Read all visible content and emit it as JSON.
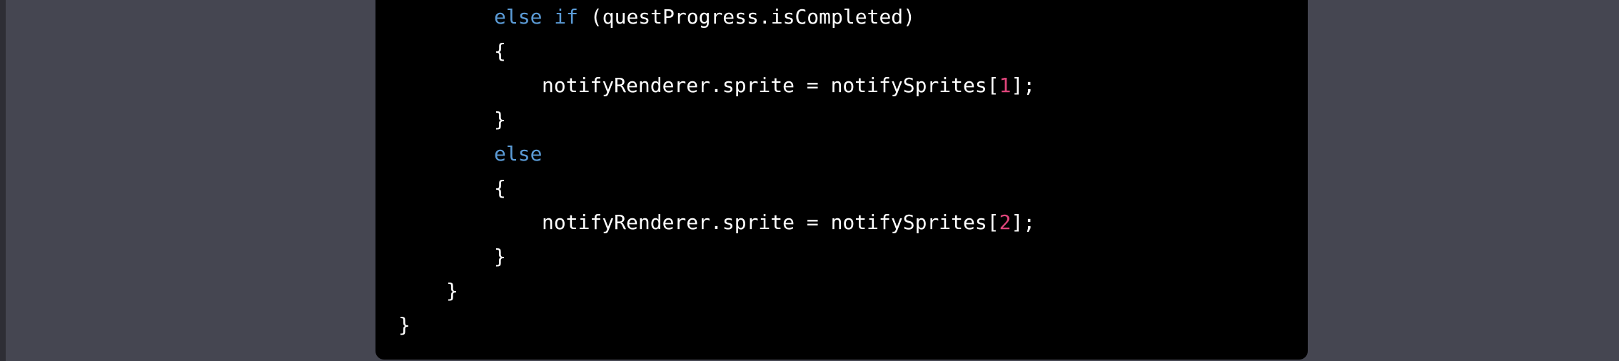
{
  "code": {
    "lines": [
      {
        "indent": 2,
        "tokens": [
          {
            "t": "else",
            "k": "keyword"
          },
          {
            "t": " "
          },
          {
            "t": "if",
            "k": "keyword"
          },
          {
            "t": " (questProgress.isCompleted)"
          }
        ]
      },
      {
        "indent": 2,
        "tokens": [
          {
            "t": "{"
          }
        ]
      },
      {
        "indent": 3,
        "tokens": [
          {
            "t": "notifyRenderer.sprite = notifySprites["
          },
          {
            "t": "1",
            "k": "number"
          },
          {
            "t": "];"
          }
        ]
      },
      {
        "indent": 2,
        "tokens": [
          {
            "t": "}"
          }
        ]
      },
      {
        "indent": 2,
        "tokens": [
          {
            "t": "else",
            "k": "keyword"
          }
        ]
      },
      {
        "indent": 2,
        "tokens": [
          {
            "t": "{"
          }
        ]
      },
      {
        "indent": 3,
        "tokens": [
          {
            "t": "notifyRenderer.sprite = notifySprites["
          },
          {
            "t": "2",
            "k": "number"
          },
          {
            "t": "];"
          }
        ]
      },
      {
        "indent": 2,
        "tokens": [
          {
            "t": "}"
          }
        ]
      },
      {
        "indent": 1,
        "tokens": [
          {
            "t": "}"
          }
        ]
      },
      {
        "indent": 0,
        "tokens": [
          {
            "t": "}"
          }
        ]
      }
    ]
  },
  "colors": {
    "page_background": "#454651",
    "code_background": "#000000",
    "code_text": "#ffffff",
    "keyword": "#5b9bd6",
    "number_literal": "#e0457b"
  }
}
